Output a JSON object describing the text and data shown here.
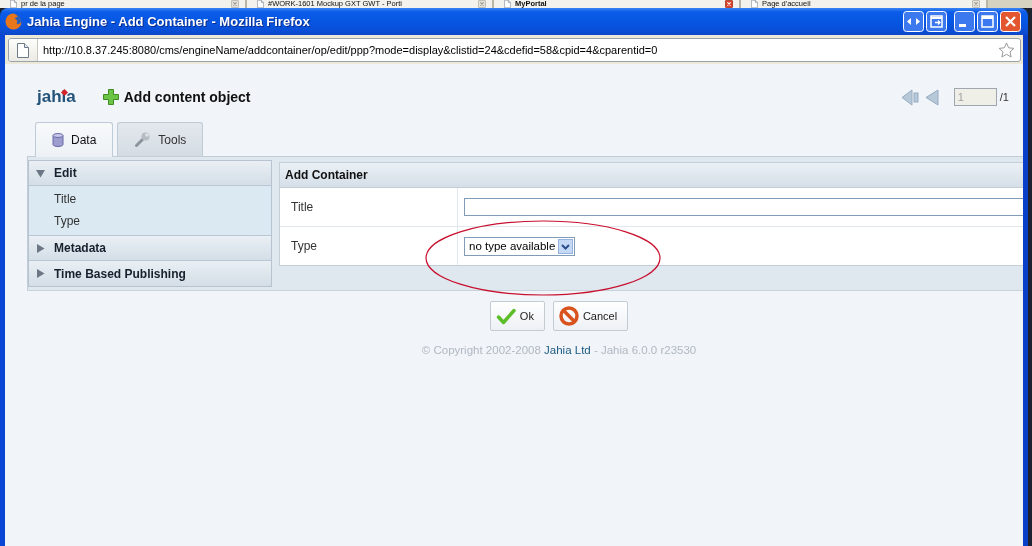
{
  "background_tabs": [
    {
      "label": "pr de la page",
      "selected": false
    },
    {
      "label": "#WORK-1601 Mockup GXT GWT - Porti",
      "selected": false
    },
    {
      "label": "MyPortal",
      "selected": true
    },
    {
      "label": "Page d'accueil",
      "selected": false
    }
  ],
  "window": {
    "title": "Jahia Engine - Add Container - Mozilla Firefox"
  },
  "address_bar": {
    "url": "http://10.8.37.245:8080/cms/engineName/addcontainer/op/edit/ppp?mode=display&clistid=24&cdefid=58&cpid=4&cparentid=0"
  },
  "header": {
    "logo": "jahia",
    "title": "Add content object"
  },
  "pager": {
    "page": "1",
    "total": "/1"
  },
  "tabs": [
    {
      "label": "Data",
      "kind": "data",
      "selected": true
    },
    {
      "label": "Tools",
      "kind": "tools",
      "selected": false
    }
  ],
  "sidebar": {
    "sections": [
      {
        "label": "Edit",
        "expanded": true,
        "items": [
          {
            "label": "Title"
          },
          {
            "label": "Type"
          }
        ]
      },
      {
        "label": "Metadata",
        "expanded": false
      },
      {
        "label": "Time Based Publishing",
        "expanded": false
      }
    ]
  },
  "form": {
    "title": "Add Container",
    "fields": [
      {
        "label": "Title",
        "kind": "text"
      },
      {
        "label": "Type",
        "kind": "select",
        "value": "no type available"
      }
    ]
  },
  "buttons": [
    {
      "label": "Ok",
      "kind": "ok"
    },
    {
      "label": "Cancel",
      "kind": "cancel"
    }
  ],
  "footer": {
    "copyright": "© Copyright 2002-2008",
    "link": "Jahia Ltd",
    "version": "- Jahia 6.0.0 r23530"
  }
}
